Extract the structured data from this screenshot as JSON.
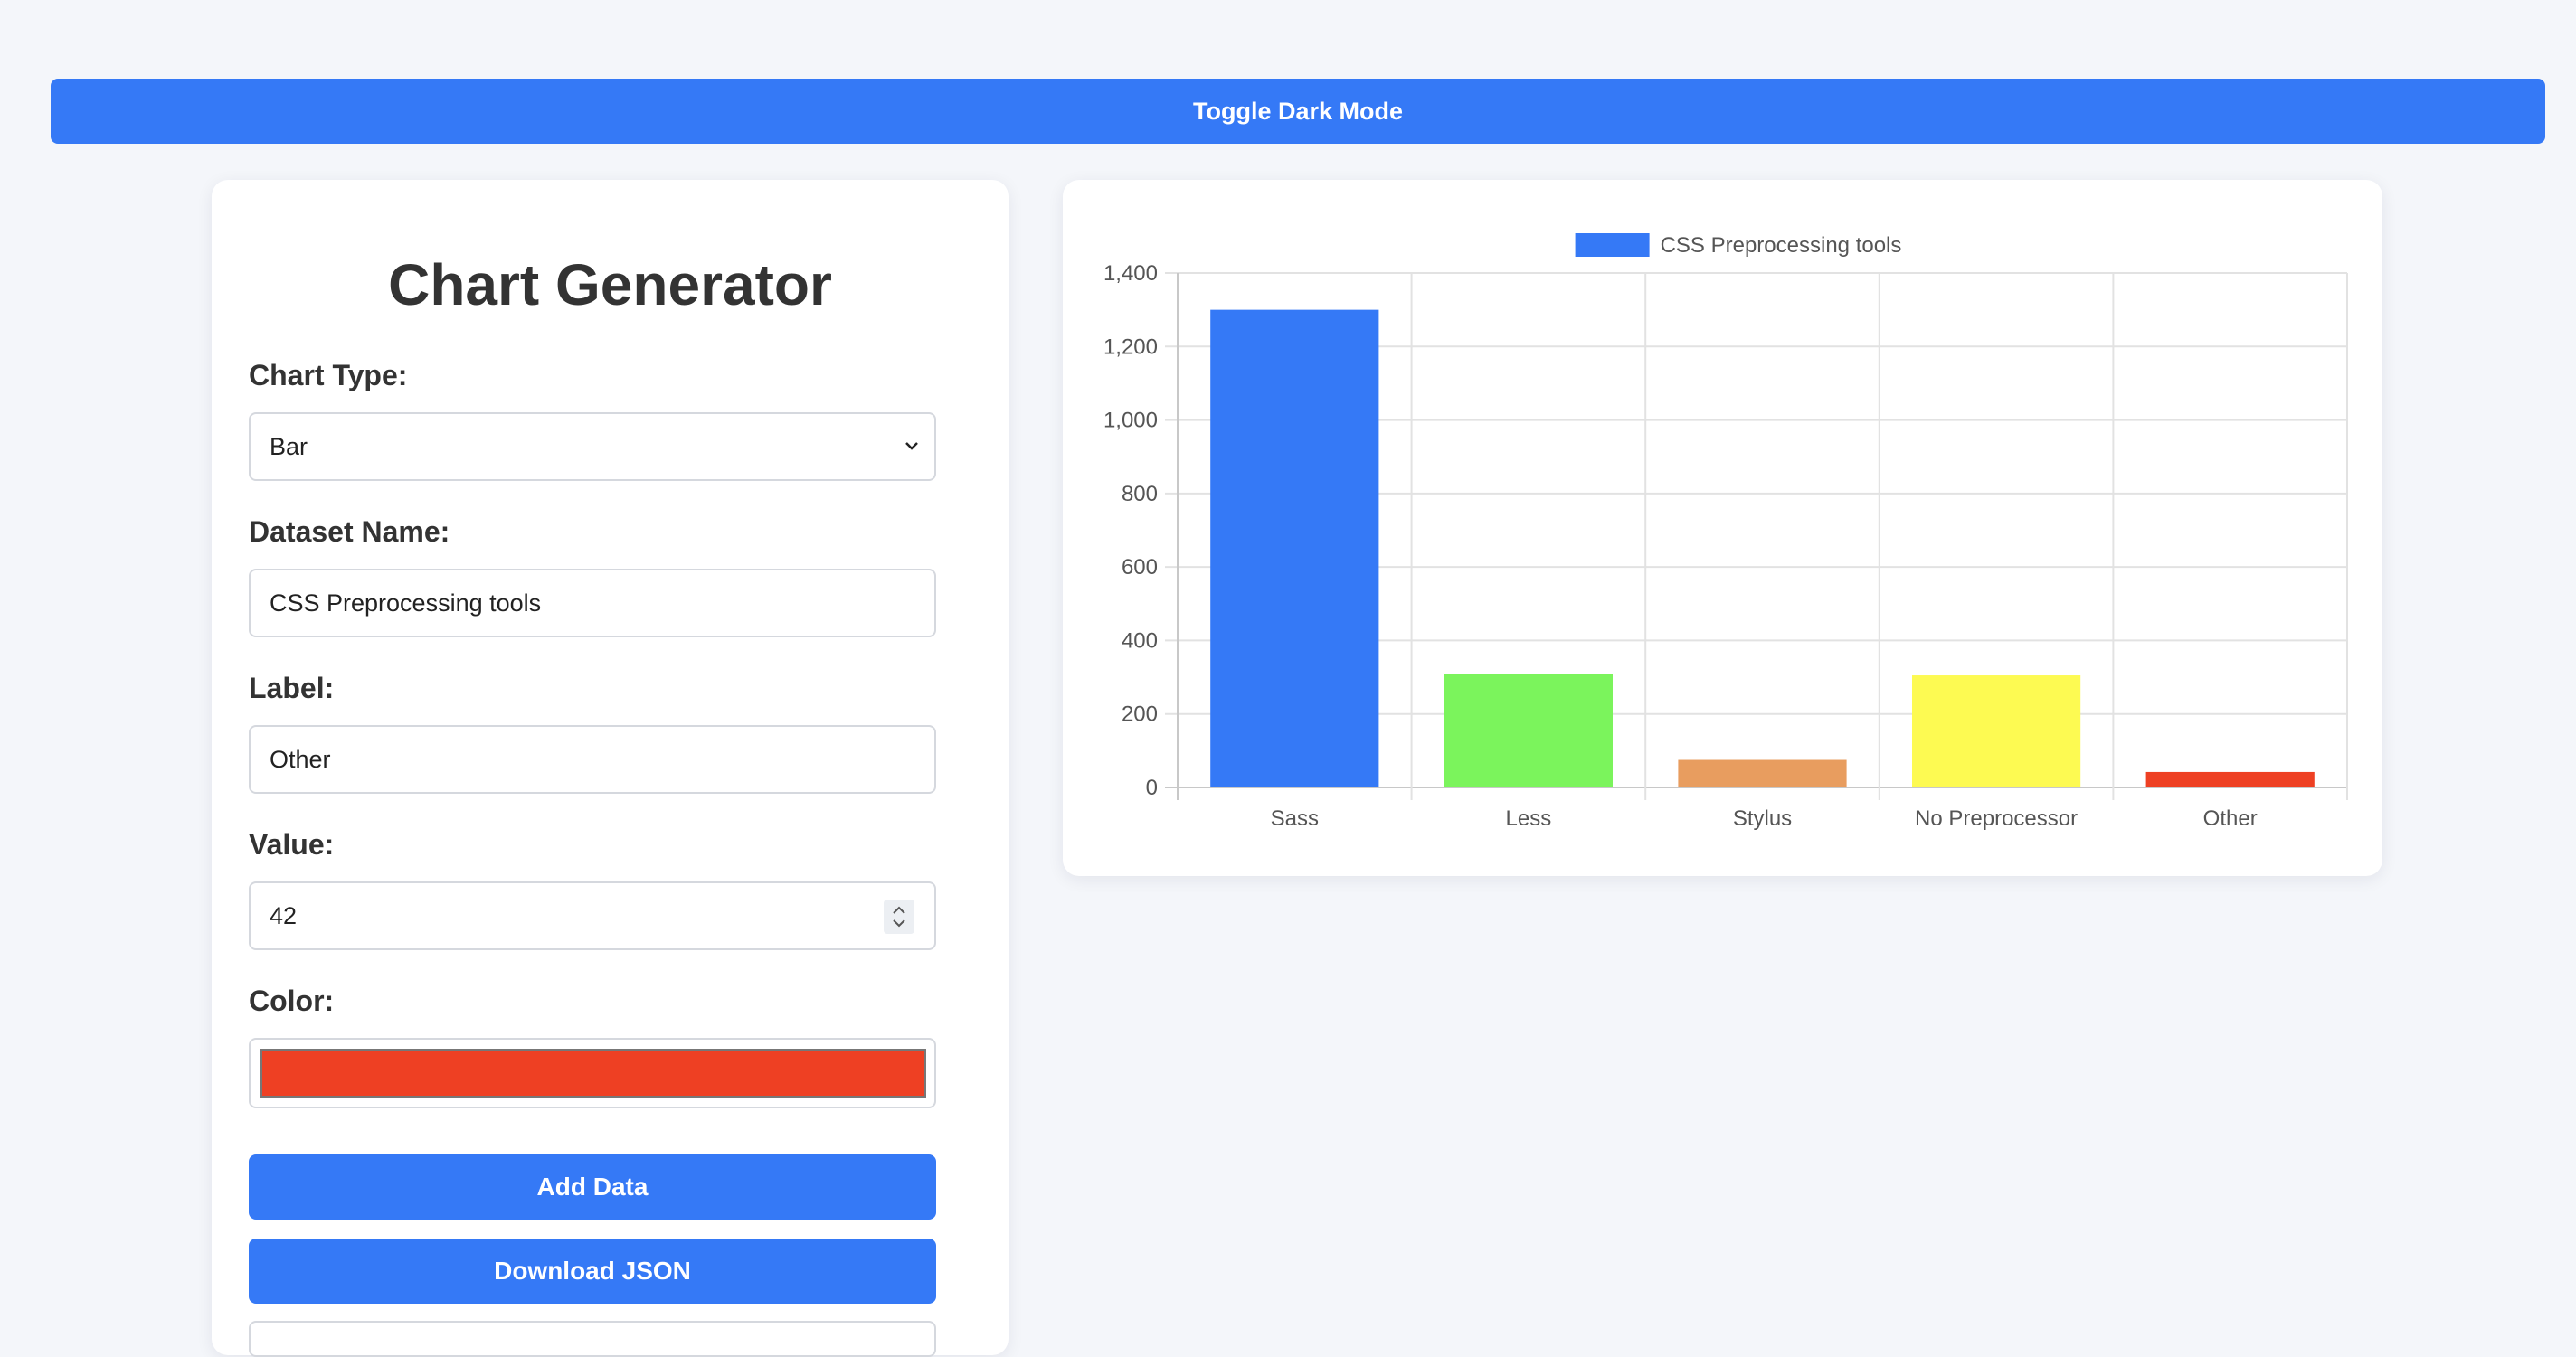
{
  "header": {
    "toggle_label": "Toggle Dark Mode"
  },
  "form": {
    "title": "Chart Generator",
    "chart_type_label": "Chart Type:",
    "chart_type_value": "Bar",
    "dataset_name_label": "Dataset Name:",
    "dataset_name_value": "CSS Preprocessing tools",
    "label_label": "Label:",
    "label_value": "Other",
    "value_label": "Value:",
    "value_value": "42",
    "color_label": "Color:",
    "color_value": "#ee4023",
    "add_button": "Add Data",
    "download_button": "Download JSON"
  },
  "colors": {
    "accent": "#3579f6",
    "background": "#f4f6fa",
    "panel": "#ffffff",
    "text": "#333333"
  },
  "chart_data": {
    "type": "bar",
    "legend": {
      "position": "top-center",
      "label": "CSS Preprocessing tools",
      "color": "#3579f6"
    },
    "categories": [
      "Sass",
      "Less",
      "Stylus",
      "No Preprocessor",
      "Other"
    ],
    "series": [
      {
        "name": "CSS Preprocessing tools",
        "values": [
          1300,
          310,
          75,
          305,
          42
        ],
        "colors": [
          "#3579f6",
          "#7bf45c",
          "#e89d5f",
          "#fdfa52",
          "#ee4023"
        ]
      }
    ],
    "ylim": [
      0,
      1400
    ],
    "yticks": [
      0,
      200,
      400,
      600,
      800,
      1000,
      1200,
      1400
    ],
    "ytick_labels": [
      "0",
      "200",
      "400",
      "600",
      "800",
      "1,000",
      "1,200",
      "1,400"
    ],
    "grid": true
  }
}
